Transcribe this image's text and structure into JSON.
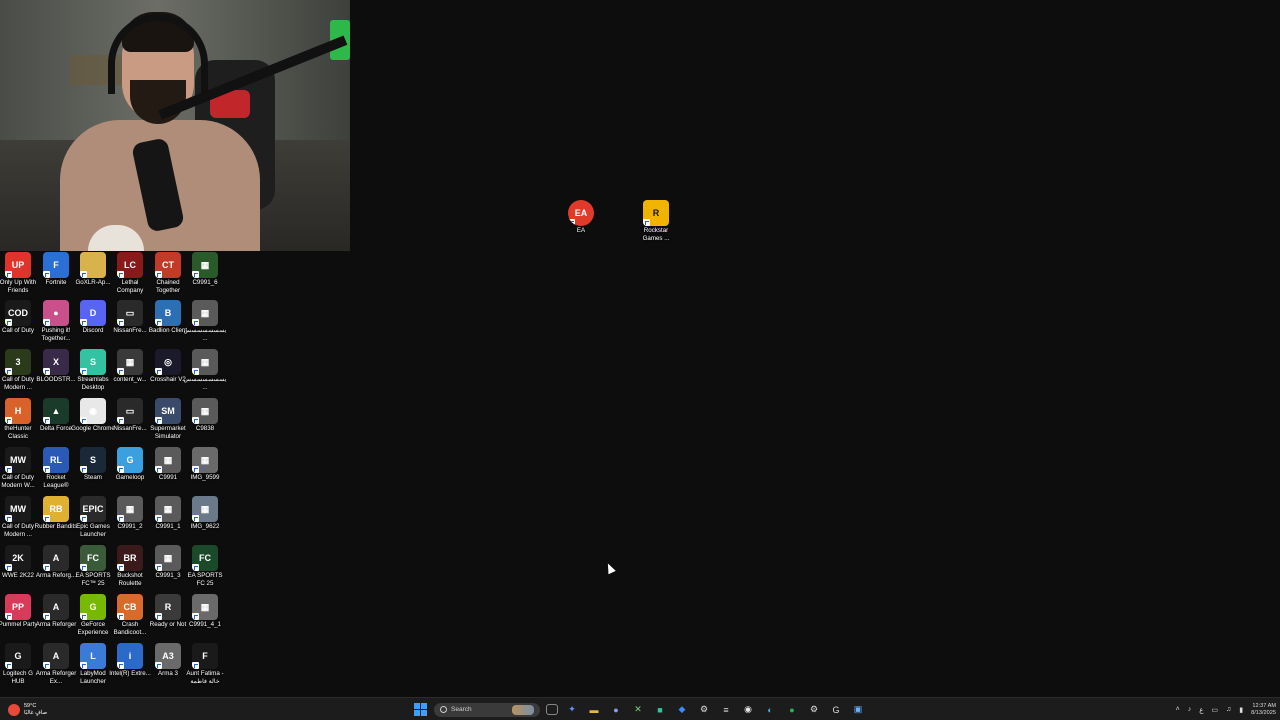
{
  "desktop_icons": [
    {
      "label": "Only Up With Friends",
      "color": "#e0342a",
      "glyph": "UP"
    },
    {
      "label": "Fortnite",
      "color": "#2a6fd6",
      "glyph": "F"
    },
    {
      "label": "GoXLR-Ap...",
      "color": "#d8b24a",
      "glyph": ""
    },
    {
      "label": "Lethal Company",
      "color": "#8a1a1a",
      "glyph": "LC"
    },
    {
      "label": "Chained Together",
      "color": "#c23a28",
      "glyph": "CT"
    },
    {
      "label": "C9991_6",
      "color": "#2a5a2a",
      "glyph": "▦"
    },
    {
      "label": "Call of Duty",
      "color": "#1a1a1a",
      "glyph": "COD"
    },
    {
      "label": "Pushing it! Together...",
      "color": "#c9508a",
      "glyph": "●"
    },
    {
      "label": "Discord",
      "color": "#5865f2",
      "glyph": "D"
    },
    {
      "label": "NissanFre...",
      "color": "#2a2a2a",
      "glyph": "▭"
    },
    {
      "label": "Badlion Client",
      "color": "#2d6fb5",
      "glyph": "B"
    },
    {
      "label": "يسسسسسسس...",
      "color": "#5a5a5a",
      "glyph": "▦"
    },
    {
      "label": "Call of Duty Modern ...",
      "color": "#2a3a1a",
      "glyph": "3"
    },
    {
      "label": "BLOODSTR...",
      "color": "#3a2a4a",
      "glyph": "X"
    },
    {
      "label": "Streamlabs Desktop",
      "color": "#31c3a2",
      "glyph": "S"
    },
    {
      "label": "content_w...",
      "color": "#3a3a3a",
      "glyph": "▦"
    },
    {
      "label": "Crosshair V2",
      "color": "#1a1a2a",
      "glyph": "◎"
    },
    {
      "label": "يسسسسسسس...",
      "color": "#5a5a5a",
      "glyph": "▦"
    },
    {
      "label": "theHunter Classic",
      "color": "#d9622a",
      "glyph": "H"
    },
    {
      "label": "Delta Force",
      "color": "#1a3a2a",
      "glyph": "▲"
    },
    {
      "label": "Google Chrome",
      "color": "#e8e8e8",
      "glyph": "◉"
    },
    {
      "label": "NissanFre...",
      "color": "#2a2a2a",
      "glyph": "▭"
    },
    {
      "label": "Supermarket Simulator",
      "color": "#3a4a6a",
      "glyph": "SM"
    },
    {
      "label": "C9838",
      "color": "#5a5a5a",
      "glyph": "▦"
    },
    {
      "label": "Call of Duty Modern W...",
      "color": "#1a1a1a",
      "glyph": "MW"
    },
    {
      "label": "Rocket League®",
      "color": "#2a5ab5",
      "glyph": "RL"
    },
    {
      "label": "Steam",
      "color": "#1b2838",
      "glyph": "S"
    },
    {
      "label": "Gameloop",
      "color": "#3aa0e0",
      "glyph": "G"
    },
    {
      "label": "C9991",
      "color": "#5a5a5a",
      "glyph": "▦"
    },
    {
      "label": "IMG_9599",
      "color": "#6a6a6a",
      "glyph": "▦"
    },
    {
      "label": "Call of Duty Modern ...",
      "color": "#1a1a1a",
      "glyph": "MW"
    },
    {
      "label": "Rubber Bandits",
      "color": "#e0b030",
      "glyph": "RB"
    },
    {
      "label": "Epic Games Launcher",
      "color": "#2a2a2a",
      "glyph": "EPIC"
    },
    {
      "label": "C9991_2",
      "color": "#5a5a5a",
      "glyph": "▦"
    },
    {
      "label": "C9991_1",
      "color": "#5a5a5a",
      "glyph": "▦"
    },
    {
      "label": "IMG_9622",
      "color": "#6a7a8a",
      "glyph": "▦"
    },
    {
      "label": "WWE 2K22",
      "color": "#1a1a1a",
      "glyph": "2K"
    },
    {
      "label": "Arma Reforg...",
      "color": "#2a2a2a",
      "glyph": "A"
    },
    {
      "label": "EA SPORTS FC™ 25",
      "color": "#3a5a3a",
      "glyph": "FC"
    },
    {
      "label": "Buckshot Roulette",
      "color": "#3a1a1a",
      "glyph": "BR"
    },
    {
      "label": "C9991_3",
      "color": "#5a5a5a",
      "glyph": "▦"
    },
    {
      "label": "EA SPORTS FC 25",
      "color": "#1a4a2a",
      "glyph": "FC"
    },
    {
      "label": "Pummel Party",
      "color": "#d83a5a",
      "glyph": "PP"
    },
    {
      "label": "Arma Reforger",
      "color": "#2a2a2a",
      "glyph": "A"
    },
    {
      "label": "GeForce Experience",
      "color": "#76b900",
      "glyph": "G"
    },
    {
      "label": "Crash Bandicoot...",
      "color": "#d86a2a",
      "glyph": "CB"
    },
    {
      "label": "Ready or Not",
      "color": "#3a3a3a",
      "glyph": "R"
    },
    {
      "label": "C9991_4_1",
      "color": "#6a6a6a",
      "glyph": "▦"
    },
    {
      "label": "Logitech G HUB",
      "color": "#1a1a1a",
      "glyph": "G"
    },
    {
      "label": "Arma Reforger Ex...",
      "color": "#2a2a2a",
      "glyph": "A"
    },
    {
      "label": "LabyMod Launcher",
      "color": "#3a7ad8",
      "glyph": "L"
    },
    {
      "label": "Intel(R) Extre...",
      "color": "#2a6ac8",
      "glyph": "i"
    },
    {
      "label": "Arma 3",
      "color": "#6a6a6a",
      "glyph": "A3"
    },
    {
      "label": "Aunt Fatima - خالة فاطمة",
      "color": "#1a1a1a",
      "glyph": "F"
    }
  ],
  "floating_icons": [
    {
      "label": "EA",
      "color": "#e03a2a",
      "glyph": "EA"
    },
    {
      "label": "Rockstar Games ...",
      "color": "#f0b400",
      "glyph": "R"
    }
  ],
  "taskbar": {
    "weather_temp": "59°C",
    "weather_desc": "صافٍ غالبًا",
    "search_placeholder": "Search",
    "time": "12:37 AM",
    "date": "8/13/2025"
  }
}
